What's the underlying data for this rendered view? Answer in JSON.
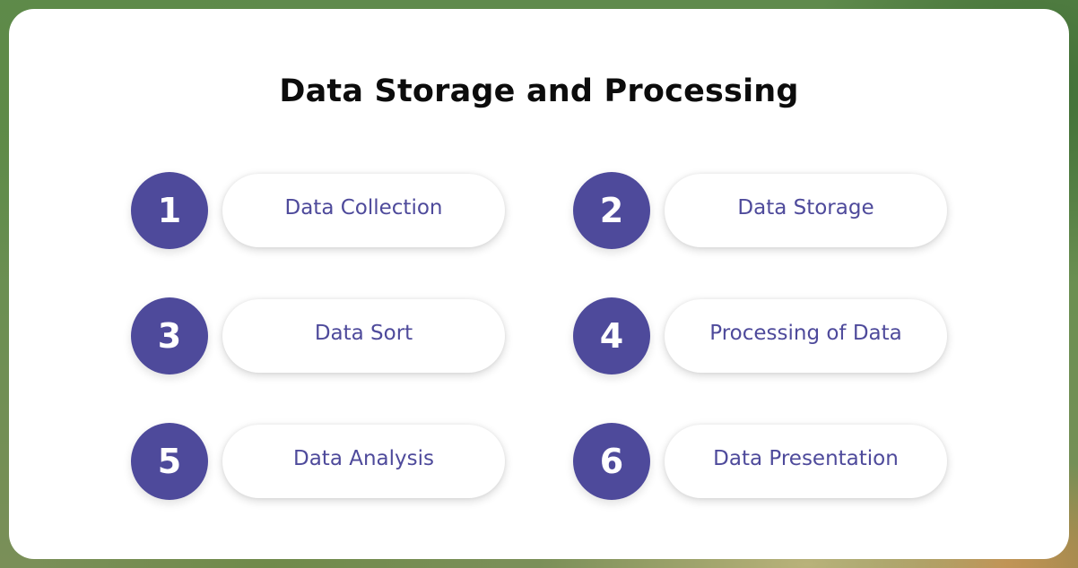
{
  "title": "Data Storage and Processing",
  "colors": {
    "accent": "#4e4a9b",
    "card_background": "#ffffff",
    "title_text": "#0c0c0c"
  },
  "steps": [
    {
      "number": "1",
      "label": "Data Collection"
    },
    {
      "number": "2",
      "label": "Data Storage"
    },
    {
      "number": "3",
      "label": "Data Sort"
    },
    {
      "number": "4",
      "label": "Processing of Data"
    },
    {
      "number": "5",
      "label": "Data Analysis"
    },
    {
      "number": "6",
      "label": "Data Presentation"
    }
  ]
}
